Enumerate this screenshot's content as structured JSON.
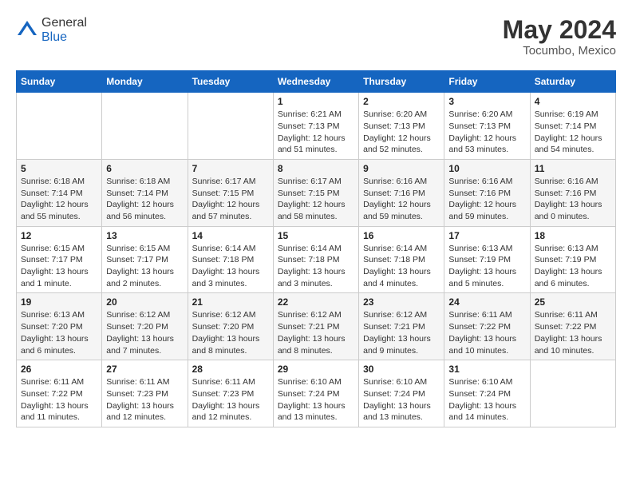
{
  "logo": {
    "general": "General",
    "blue": "Blue"
  },
  "header": {
    "month_year": "May 2024",
    "location": "Tocumbo, Mexico"
  },
  "days_of_week": [
    "Sunday",
    "Monday",
    "Tuesday",
    "Wednesday",
    "Thursday",
    "Friday",
    "Saturday"
  ],
  "weeks": [
    [
      {
        "day": "",
        "info": ""
      },
      {
        "day": "",
        "info": ""
      },
      {
        "day": "",
        "info": ""
      },
      {
        "day": "1",
        "info": "Sunrise: 6:21 AM\nSunset: 7:13 PM\nDaylight: 12 hours\nand 51 minutes."
      },
      {
        "day": "2",
        "info": "Sunrise: 6:20 AM\nSunset: 7:13 PM\nDaylight: 12 hours\nand 52 minutes."
      },
      {
        "day": "3",
        "info": "Sunrise: 6:20 AM\nSunset: 7:13 PM\nDaylight: 12 hours\nand 53 minutes."
      },
      {
        "day": "4",
        "info": "Sunrise: 6:19 AM\nSunset: 7:14 PM\nDaylight: 12 hours\nand 54 minutes."
      }
    ],
    [
      {
        "day": "5",
        "info": "Sunrise: 6:18 AM\nSunset: 7:14 PM\nDaylight: 12 hours\nand 55 minutes."
      },
      {
        "day": "6",
        "info": "Sunrise: 6:18 AM\nSunset: 7:14 PM\nDaylight: 12 hours\nand 56 minutes."
      },
      {
        "day": "7",
        "info": "Sunrise: 6:17 AM\nSunset: 7:15 PM\nDaylight: 12 hours\nand 57 minutes."
      },
      {
        "day": "8",
        "info": "Sunrise: 6:17 AM\nSunset: 7:15 PM\nDaylight: 12 hours\nand 58 minutes."
      },
      {
        "day": "9",
        "info": "Sunrise: 6:16 AM\nSunset: 7:16 PM\nDaylight: 12 hours\nand 59 minutes."
      },
      {
        "day": "10",
        "info": "Sunrise: 6:16 AM\nSunset: 7:16 PM\nDaylight: 12 hours\nand 59 minutes."
      },
      {
        "day": "11",
        "info": "Sunrise: 6:16 AM\nSunset: 7:16 PM\nDaylight: 13 hours\nand 0 minutes."
      }
    ],
    [
      {
        "day": "12",
        "info": "Sunrise: 6:15 AM\nSunset: 7:17 PM\nDaylight: 13 hours\nand 1 minute."
      },
      {
        "day": "13",
        "info": "Sunrise: 6:15 AM\nSunset: 7:17 PM\nDaylight: 13 hours\nand 2 minutes."
      },
      {
        "day": "14",
        "info": "Sunrise: 6:14 AM\nSunset: 7:18 PM\nDaylight: 13 hours\nand 3 minutes."
      },
      {
        "day": "15",
        "info": "Sunrise: 6:14 AM\nSunset: 7:18 PM\nDaylight: 13 hours\nand 3 minutes."
      },
      {
        "day": "16",
        "info": "Sunrise: 6:14 AM\nSunset: 7:18 PM\nDaylight: 13 hours\nand 4 minutes."
      },
      {
        "day": "17",
        "info": "Sunrise: 6:13 AM\nSunset: 7:19 PM\nDaylight: 13 hours\nand 5 minutes."
      },
      {
        "day": "18",
        "info": "Sunrise: 6:13 AM\nSunset: 7:19 PM\nDaylight: 13 hours\nand 6 minutes."
      }
    ],
    [
      {
        "day": "19",
        "info": "Sunrise: 6:13 AM\nSunset: 7:20 PM\nDaylight: 13 hours\nand 6 minutes."
      },
      {
        "day": "20",
        "info": "Sunrise: 6:12 AM\nSunset: 7:20 PM\nDaylight: 13 hours\nand 7 minutes."
      },
      {
        "day": "21",
        "info": "Sunrise: 6:12 AM\nSunset: 7:20 PM\nDaylight: 13 hours\nand 8 minutes."
      },
      {
        "day": "22",
        "info": "Sunrise: 6:12 AM\nSunset: 7:21 PM\nDaylight: 13 hours\nand 8 minutes."
      },
      {
        "day": "23",
        "info": "Sunrise: 6:12 AM\nSunset: 7:21 PM\nDaylight: 13 hours\nand 9 minutes."
      },
      {
        "day": "24",
        "info": "Sunrise: 6:11 AM\nSunset: 7:22 PM\nDaylight: 13 hours\nand 10 minutes."
      },
      {
        "day": "25",
        "info": "Sunrise: 6:11 AM\nSunset: 7:22 PM\nDaylight: 13 hours\nand 10 minutes."
      }
    ],
    [
      {
        "day": "26",
        "info": "Sunrise: 6:11 AM\nSunset: 7:22 PM\nDaylight: 13 hours\nand 11 minutes."
      },
      {
        "day": "27",
        "info": "Sunrise: 6:11 AM\nSunset: 7:23 PM\nDaylight: 13 hours\nand 12 minutes."
      },
      {
        "day": "28",
        "info": "Sunrise: 6:11 AM\nSunset: 7:23 PM\nDaylight: 13 hours\nand 12 minutes."
      },
      {
        "day": "29",
        "info": "Sunrise: 6:10 AM\nSunset: 7:24 PM\nDaylight: 13 hours\nand 13 minutes."
      },
      {
        "day": "30",
        "info": "Sunrise: 6:10 AM\nSunset: 7:24 PM\nDaylight: 13 hours\nand 13 minutes."
      },
      {
        "day": "31",
        "info": "Sunrise: 6:10 AM\nSunset: 7:24 PM\nDaylight: 13 hours\nand 14 minutes."
      },
      {
        "day": "",
        "info": ""
      }
    ]
  ]
}
